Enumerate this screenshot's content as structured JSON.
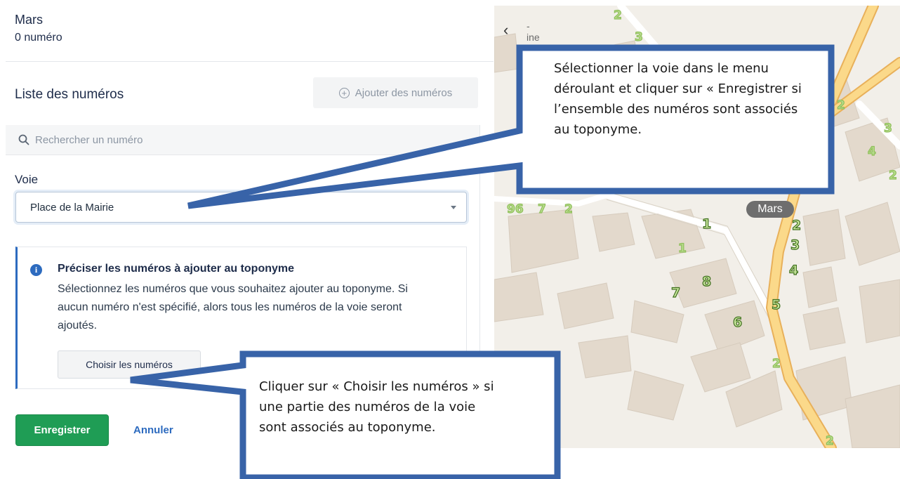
{
  "header": {
    "title": "Mars",
    "subtitle": "0 numéro"
  },
  "list": {
    "title": "Liste des numéros",
    "add_button": "Ajouter des numéros"
  },
  "search": {
    "placeholder": "Rechercher un numéro"
  },
  "voie": {
    "label": "Voie",
    "selected": "Place de la Mairie"
  },
  "info": {
    "title": "Préciser les numéros à ajouter au toponyme",
    "body": "Sélectionnez les numéros que vous souhaitez ajouter au toponyme. Si aucun numéro n'est spécifié, alors tous les numéros de la voie seront ajoutés.",
    "choose_button": "Choisir les numéros"
  },
  "actions": {
    "save": "Enregistrer",
    "cancel": "Annuler"
  },
  "map": {
    "place_label": "Mars",
    "collapse_glyph": "‹",
    "partial_label": "-\nine",
    "house_numbers": [
      "1",
      "2",
      "3",
      "4",
      "5",
      "6",
      "7",
      "8",
      "1",
      "2",
      "2",
      "3",
      "4",
      "2",
      "96",
      "7",
      "2",
      "2",
      "2",
      "3"
    ]
  },
  "callouts": [
    {
      "text": "Sélectionner la voie dans le menu déroulant et cliquer sur « Enregistrer si l’ensemble des numéros sont associés au toponyme."
    },
    {
      "text": "Cliquer sur « Choisir les numéros » si une partie des numéros de la voie sont associés au toponyme."
    }
  ],
  "colors": {
    "accent": "#2d6bbf",
    "save": "#1f9d55",
    "callout_border": "#3863a8",
    "house_number": "#7dbb3a"
  }
}
